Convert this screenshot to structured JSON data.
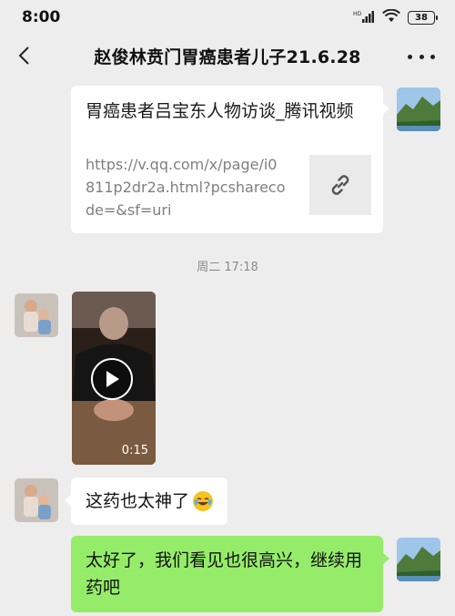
{
  "status_bar": {
    "time": "8:00",
    "signal_label": "HD",
    "battery_level": "38"
  },
  "nav": {
    "title": "赵俊林贲门胃癌患者儿子21.6.28"
  },
  "messages": {
    "link_card": {
      "title": "胃癌患者吕宝东人物访谈_腾讯视频",
      "url": "https://v.qq.com/x/page/i0811p2dr2a.html?pcsharecode=&sf=uri"
    },
    "divider_time": "周二 17:18",
    "video": {
      "duration": "0:15"
    },
    "text_left": "这药也太神了",
    "text_right": "太好了，我们看见也很高兴，继续用药吧"
  },
  "colors": {
    "background": "#ededed",
    "bubble_white": "#ffffff",
    "bubble_green": "#95ec69"
  }
}
